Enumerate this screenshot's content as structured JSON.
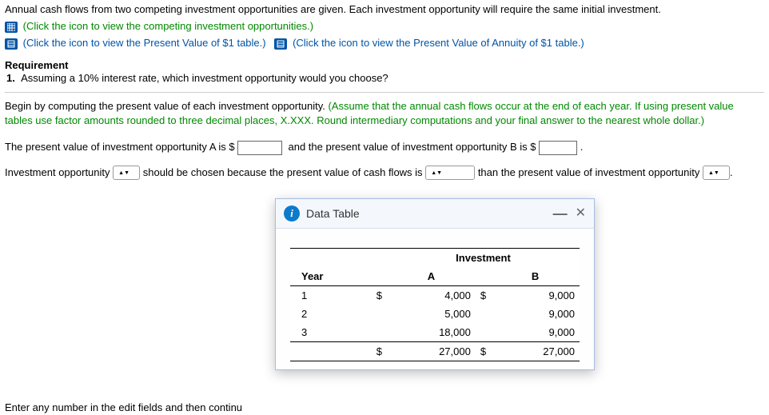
{
  "intro": "Annual cash flows from two competing investment opportunities are given. Each investment opportunity will require the same initial investment.",
  "links": {
    "opportunities": "(Click the icon to view the competing investment opportunities.)",
    "pv1": "(Click the icon to view the Present Value of $1 table.)",
    "pvannuity": "(Click the icon to view the Present Value of Annuity of $1 table.)"
  },
  "requirement": {
    "heading": "Requirement",
    "item1_num": "1.",
    "item1_text": "Assuming a 10% interest rate, which investment opportunity would you choose?"
  },
  "instruction_lead": "Begin by computing the present value of each investment opportunity. ",
  "instruction_paren": "(Assume that the annual cash flows occur at the end of each year. If using present value tables use factor amounts rounded to three decimal places, X.XXX. Round intermediary computations and your final answer to the nearest whole dollar.)",
  "sentence1_a": "The present value of investment opportunity A is $",
  "sentence1_b": "and the present value of investment opportunity B is $",
  "period": ".",
  "sentence2_a": "Investment opportunity",
  "sentence2_b": "should be chosen because the present value of cash flows is",
  "sentence2_c": "than the present value of investment opportunity",
  "dialog": {
    "title": "Data Table",
    "table_header_group": "Investment",
    "col_year": "Year",
    "col_a": "A",
    "col_b": "B"
  },
  "chart_data": {
    "type": "table",
    "columns": [
      "Year",
      "Investment A",
      "Investment B"
    ],
    "rows": [
      {
        "year": "1",
        "a": 4000,
        "b": 9000
      },
      {
        "year": "2",
        "a": 5000,
        "b": 9000
      },
      {
        "year": "3",
        "a": 18000,
        "b": 9000
      }
    ],
    "totals": {
      "a": 27000,
      "b": 27000
    }
  },
  "display": {
    "r1": {
      "year": "1",
      "a": "4,000",
      "b": "9,000"
    },
    "r2": {
      "year": "2",
      "a": "5,000",
      "b": "9,000"
    },
    "r3": {
      "year": "3",
      "a": "18,000",
      "b": "9,000"
    },
    "tot": {
      "a": "27,000",
      "b": "27,000"
    },
    "currency": "$"
  },
  "footer_hint": "Enter any number in the edit fields and then continu"
}
